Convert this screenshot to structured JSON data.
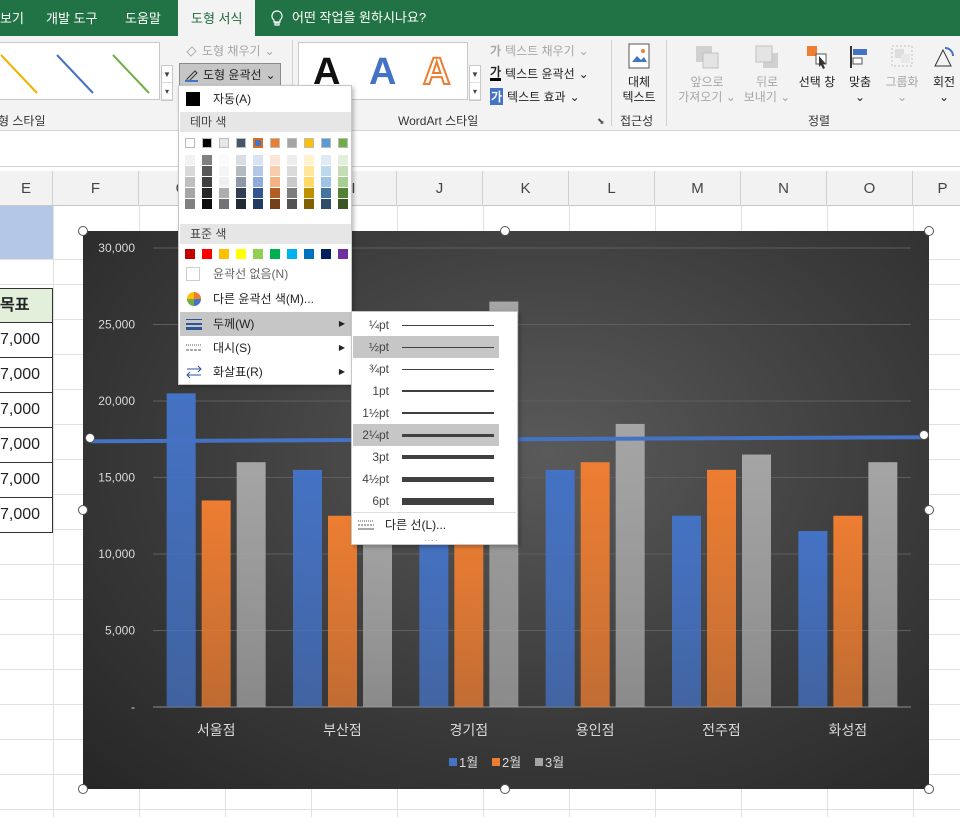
{
  "tabs": [
    {
      "label": "보기",
      "active": false
    },
    {
      "label": "개발 도구",
      "active": false
    },
    {
      "label": "도움말",
      "active": false
    },
    {
      "label": "도형 서식",
      "active": true
    }
  ],
  "tell_me": "어떤 작업을 원하시나요?",
  "ribbon": {
    "shape_styles_label": "형 스타일",
    "shape_fill": "도형 채우기",
    "shape_outline": "도형 윤곽선",
    "wordart_label": "WordArt 스타일",
    "text_fill": "텍스트 채우기",
    "text_outline": "텍스트 윤곽선",
    "text_effects": "텍스트 효과",
    "wordart_letter": "A",
    "accessibility_label": "접근성",
    "alt_text_line1": "대체",
    "alt_text_line2": "텍스트",
    "arrange_label": "정렬",
    "bring_forward_1": "앞으로",
    "bring_forward_2": "가져오기",
    "send_backward_1": "뒤로",
    "send_backward_2": "보내기",
    "selection_pane": "선택 창",
    "align": "맞춤",
    "group": "그룹화",
    "rotate": "회전"
  },
  "sheet": {
    "columns": [
      "E",
      "F",
      "G",
      "H",
      "I",
      "J",
      "K",
      "L",
      "M",
      "N",
      "O",
      "P"
    ],
    "header_cell": "목표",
    "values": [
      "7,000",
      "7,000",
      "7,000",
      "7,000",
      "7,000",
      "7,000"
    ]
  },
  "outline_menu": {
    "auto": "자동(A)",
    "theme_colors_header": "테마 색",
    "standard_colors_header": "표준 색",
    "no_outline": "윤곽선 없음(N)",
    "more_colors": "다른 윤곽선 색(M)...",
    "weight": "두께(W)",
    "dashes": "대시(S)",
    "arrows": "화살표(R)",
    "theme_top": [
      "#ffffff",
      "#000000",
      "#e7e6e6",
      "#44546a",
      "#4472c4",
      "#ed7d31",
      "#a5a5a5",
      "#ffc000",
      "#5b9bd5",
      "#70ad47"
    ],
    "standard": [
      "#c00000",
      "#ff0000",
      "#ffc000",
      "#ffff00",
      "#92d050",
      "#00b050",
      "#00b0f0",
      "#0070c0",
      "#002060",
      "#7030a0"
    ]
  },
  "weight_menu": {
    "items": [
      {
        "label": "¼pt",
        "highlighted": false
      },
      {
        "label": "½pt",
        "highlighted": true
      },
      {
        "label": "¾pt",
        "highlighted": false
      },
      {
        "label": "1pt",
        "highlighted": false
      },
      {
        "label": "1½pt",
        "highlighted": false
      },
      {
        "label": "2¼pt",
        "highlighted": true
      },
      {
        "label": "3pt",
        "highlighted": false
      },
      {
        "label": "4½pt",
        "highlighted": false
      },
      {
        "label": "6pt",
        "highlighted": false
      }
    ],
    "more_lines": "다른 선(L)..."
  },
  "chart_data": {
    "type": "bar",
    "categories": [
      "서울점",
      "부산점",
      "경기점",
      "용인점",
      "전주점",
      "화성점"
    ],
    "series": [
      {
        "name": "1월",
        "color": "#4472c4",
        "values": [
          20500,
          15500,
          12500,
          15500,
          12500,
          11500
        ]
      },
      {
        "name": "2월",
        "color": "#ed7d31",
        "values": [
          13500,
          12500,
          12500,
          16000,
          15500,
          12500
        ]
      },
      {
        "name": "3월",
        "color": "#a5a5a5",
        "values": [
          16000,
          12500,
          26500,
          18500,
          16500,
          16000
        ]
      }
    ],
    "target_line": {
      "value": 17500,
      "color": "#4472c4"
    },
    "ylim": [
      0,
      30000
    ],
    "yticks": [
      "-",
      "5,000",
      "10,000",
      "15,000",
      "20,000",
      "25,000",
      "30,000"
    ],
    "legend_position": "bottom",
    "grid": true
  }
}
